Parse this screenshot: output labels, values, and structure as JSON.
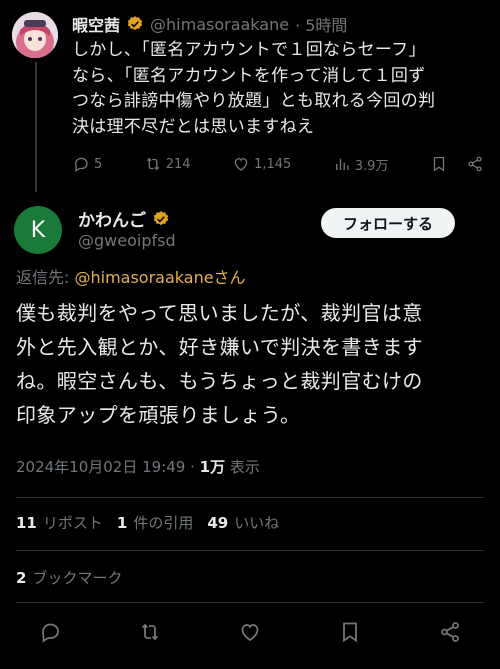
{
  "parent_tweet": {
    "author_name": "暇空茜",
    "handle": "@himasoraakane",
    "time": "· 5時間",
    "text_lines": [
      "しかし、「匿名アカウントで１回ならセーフ」",
      "なら、「匿名アカウントを作って消して１回ず",
      "つなら誹謗中傷やり放題」とも取れる今回の判",
      "決は理不尽だとは思いますねえ"
    ],
    "replies": "5",
    "reposts": "214",
    "likes": "1,145",
    "views": "3.9万"
  },
  "main_tweet": {
    "avatar_letter": "K",
    "author_name": "かわんご",
    "handle": "@gweoipfsd",
    "follow_label": "フォローする",
    "reply_prefix": "返信先: ",
    "reply_to": "@himasoraakaneさん",
    "text_lines": [
      "僕も裁判をやって思いましたが、裁判官は意",
      "外と先入観とか、好き嫌いで判決を書きます",
      "ね。暇空さんも、もうちょっと裁判官むけの",
      "印象アップを頑張りましょう。"
    ],
    "timestamp": "2024年10月02日 19:49 · ",
    "views_count": "1万",
    "views_label": " 表示",
    "repost_count": "11",
    "repost_label": "リポスト",
    "quote_count": "1",
    "quote_label": "件の引用",
    "like_count": "49",
    "like_label": "いいね",
    "bookmark_count": "2",
    "bookmark_label": "ブックマーク"
  },
  "colors": {
    "background": "#000000",
    "text": "#e7e9ea",
    "muted": "#71767b",
    "verified_gold": "#e0a41c",
    "mention": "#e3b04b",
    "avatar_green": "#1a7a3a"
  }
}
